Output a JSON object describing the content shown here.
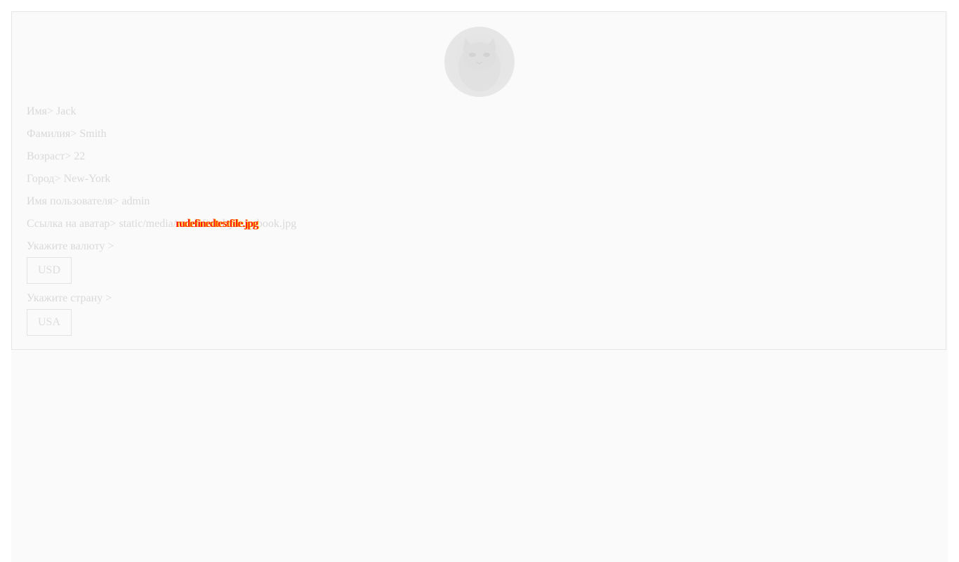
{
  "profile": {
    "avatar_icon": "cat-avatar-icon",
    "name_label": "Имя",
    "name_value": "Jack",
    "surname_label": "Фамилия",
    "surname_value": "Smith",
    "age_label": "Возраст",
    "age_value": "22",
    "city_label": "Город",
    "city_value": "New-York",
    "username_label": "Имя пользователя",
    "username_value": "admin",
    "avatar_link_label": "Ссылка на аватар",
    "avatar_link_prefix": "static/media/",
    "avatar_link_file_shown": "rundefinedrystorybook.jpg",
    "avatar_link_overlay": "rudefinedtestfile.jpg",
    "separator": ">"
  },
  "currency": {
    "label": "Укажите валюту >",
    "selected": "USD"
  },
  "country": {
    "label": "Укажите страну >",
    "selected": "USA"
  }
}
